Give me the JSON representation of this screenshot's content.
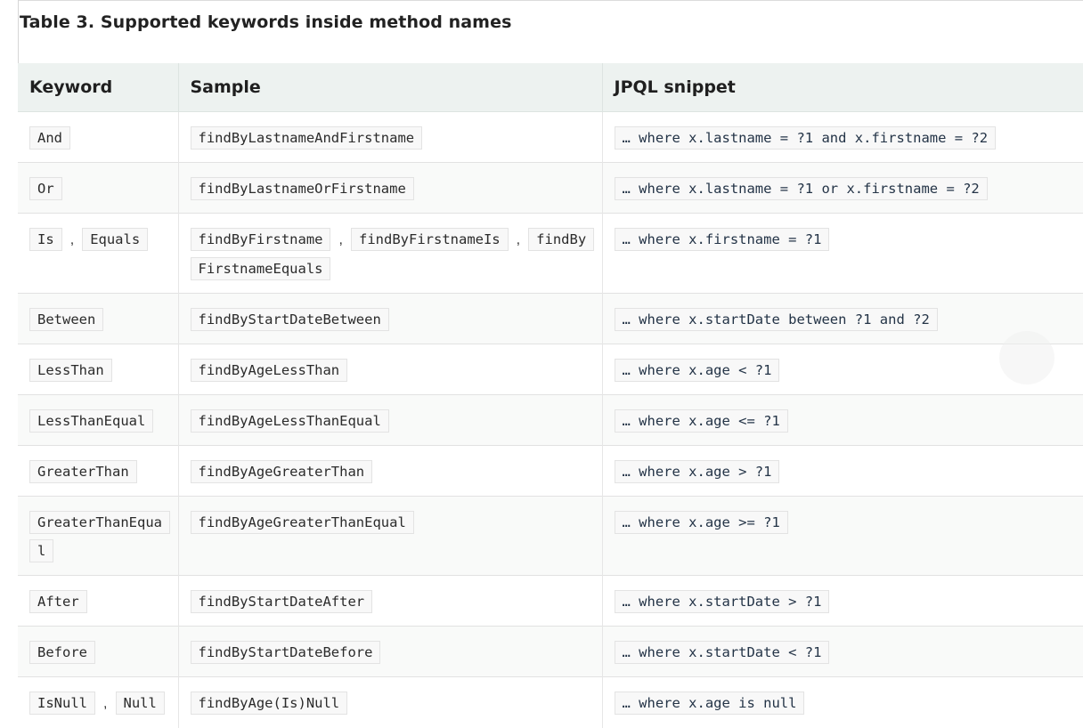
{
  "caption": "Table 3. Supported keywords inside method names",
  "headers": [
    "Keyword",
    "Sample",
    "JPQL snippet"
  ],
  "rows": [
    {
      "keywords": [
        "And"
      ],
      "samples": [
        "findByLastnameAndFirstname"
      ],
      "jpql": "… where x.lastname = ?1 and x.firstname = ?2"
    },
    {
      "keywords": [
        "Or"
      ],
      "samples": [
        "findByLastnameOrFirstname"
      ],
      "jpql": "… where x.lastname = ?1 or x.firstname = ?2"
    },
    {
      "keywords": [
        "Is",
        "Equals"
      ],
      "samples": [
        "findByFirstname",
        "findByFirstnameIs",
        "findByFirstnameEquals"
      ],
      "jpql": "… where x.firstname = ?1"
    },
    {
      "keywords": [
        "Between"
      ],
      "samples": [
        "findByStartDateBetween"
      ],
      "jpql": "… where x.startDate between ?1 and ?2"
    },
    {
      "keywords": [
        "LessThan"
      ],
      "samples": [
        "findByAgeLessThan"
      ],
      "jpql": "… where x.age < ?1"
    },
    {
      "keywords": [
        "LessThanEqual"
      ],
      "samples": [
        "findByAgeLessThanEqual"
      ],
      "jpql": "… where x.age <= ?1"
    },
    {
      "keywords": [
        "GreaterThan"
      ],
      "samples": [
        "findByAgeGreaterThan"
      ],
      "jpql": "… where x.age > ?1"
    },
    {
      "keywords": [
        "GreaterThanEqual"
      ],
      "samples": [
        "findByAgeGreaterThanEqual"
      ],
      "jpql": "… where x.age >= ?1"
    },
    {
      "keywords": [
        "After"
      ],
      "samples": [
        "findByStartDateAfter"
      ],
      "jpql": "… where x.startDate > ?1"
    },
    {
      "keywords": [
        "Before"
      ],
      "samples": [
        "findByStartDateBefore"
      ],
      "jpql": "… where x.startDate < ?1"
    },
    {
      "keywords": [
        "IsNull",
        "Null"
      ],
      "samples": [
        "findByAge(Is)Null"
      ],
      "jpql": "… where x.age is null"
    }
  ],
  "separator": ","
}
